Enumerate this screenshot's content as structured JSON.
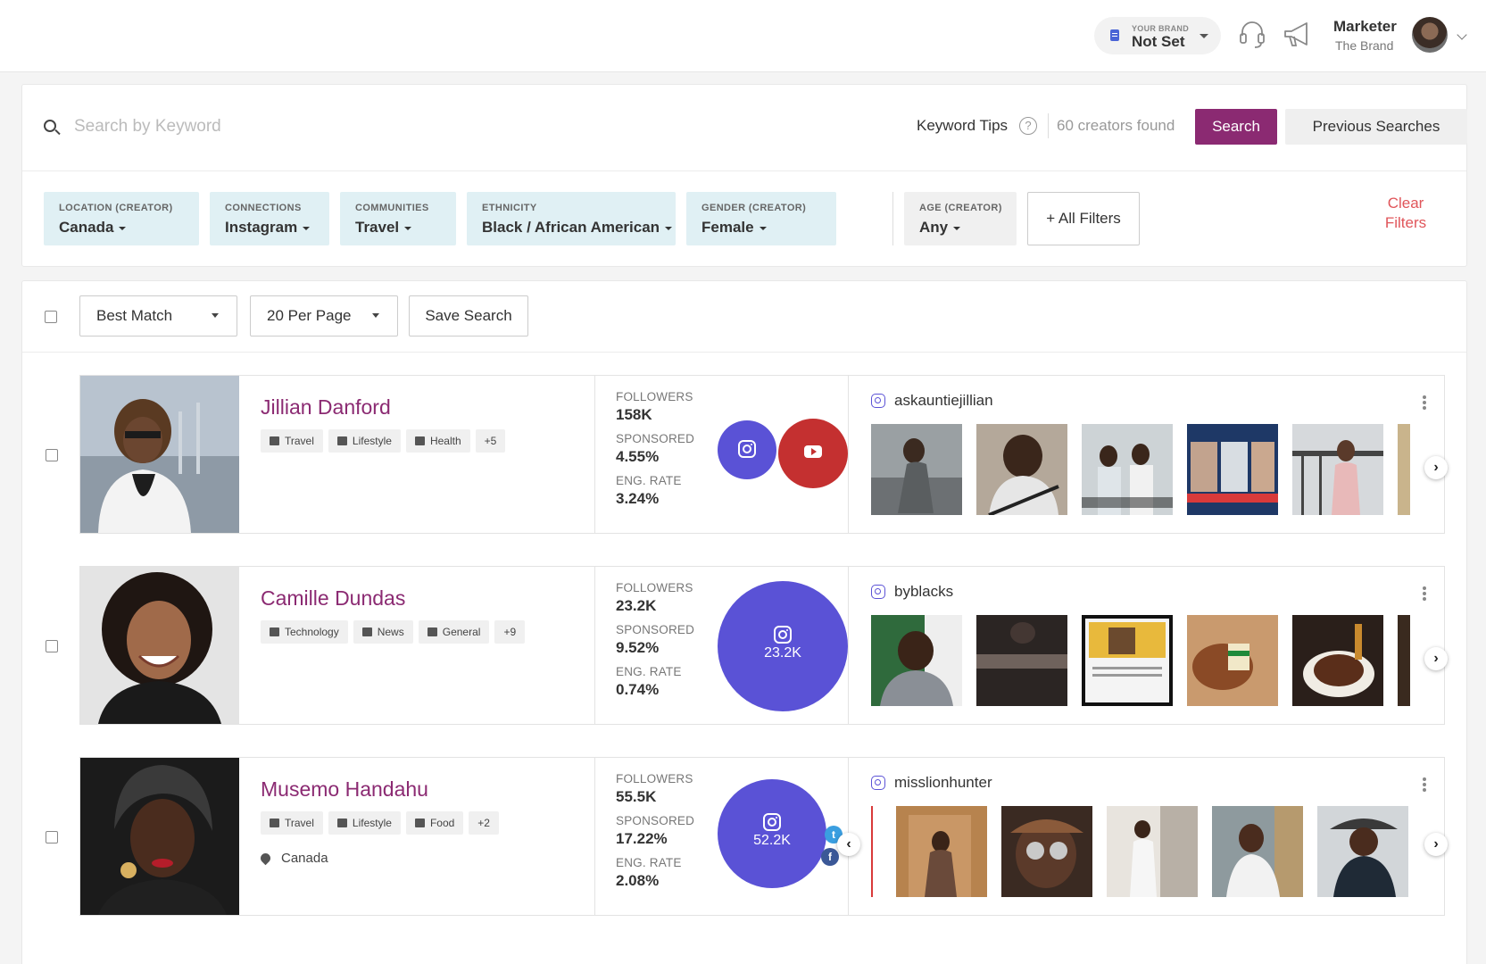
{
  "header": {
    "brand_label": "YOUR BRAND",
    "brand_value": "Not Set",
    "user_name": "Marketer",
    "user_sub": "The Brand",
    "icons": [
      "support-headset-icon",
      "megaphone-icon"
    ]
  },
  "search": {
    "placeholder": "Search by Keyword",
    "keyword_tips": "Keyword Tips",
    "help_glyph": "?",
    "found_text": "60 creators found",
    "search_button": "Search",
    "previous_button": "Previous Searches"
  },
  "filters": [
    {
      "label": "LOCATION (CREATOR)",
      "value": "Canada"
    },
    {
      "label": "CONNECTIONS",
      "value": "Instagram"
    },
    {
      "label": "COMMUNITIES",
      "value": "Travel"
    },
    {
      "label": "ETHNICITY",
      "value": "Black / African American"
    },
    {
      "label": "GENDER (CREATOR)",
      "value": "Female"
    },
    {
      "label": "AGE (CREATOR)",
      "value": "Any"
    }
  ],
  "all_filters": "+ All Filters",
  "clear_filters": "Clear Filters",
  "toolbar": {
    "sort": "Best Match",
    "per_page": "20 Per Page",
    "save": "Save Search"
  },
  "stat_labels": {
    "followers": "FOLLOWERS",
    "sponsored": "SPONSORED",
    "eng": "ENG. RATE"
  },
  "creators": [
    {
      "name": "Jillian Danford",
      "tags": [
        "Travel",
        "Lifestyle",
        "Health",
        "+5"
      ],
      "followers": "158K",
      "sponsored": "4.55%",
      "eng_rate": "3.24%",
      "handle": "askauntiejillian",
      "colors": {
        "instagram": "#5a52d6",
        "youtube": "#c43030"
      }
    },
    {
      "name": "Camille Dundas",
      "tags": [
        "Technology",
        "News",
        "General",
        "+9"
      ],
      "followers": "23.2K",
      "sponsored": "9.52%",
      "eng_rate": "0.74%",
      "circle_value": "23.2K",
      "handle": "byblacks"
    },
    {
      "name": "Musemo Handahu",
      "tags": [
        "Travel",
        "Lifestyle",
        "Food",
        "+2"
      ],
      "location": "Canada",
      "followers": "55.5K",
      "sponsored": "17.22%",
      "eng_rate": "2.08%",
      "circle_value": "52.2K",
      "handle": "misslionhunter",
      "twitter_glyph": "t",
      "facebook_glyph": "f"
    }
  ],
  "arrows": {
    "next": "›",
    "prev": "‹"
  },
  "colors": {
    "accent": "#8b2a72",
    "instagram": "#5a52d6",
    "filter_bg": "#e0f0f4",
    "clear": "#e0555a"
  }
}
